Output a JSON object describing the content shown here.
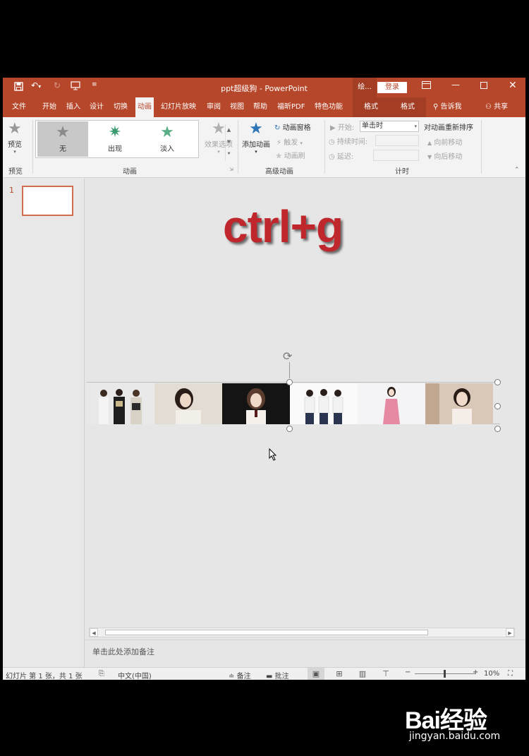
{
  "window": {
    "doc_title": "ppt超级狗 - PowerPoint",
    "tell_hint": "绘...",
    "login_label": "登录"
  },
  "tabs": [
    "文件",
    "开始",
    "插入",
    "设计",
    "切换",
    "动画",
    "幻灯片放映",
    "审阅",
    "视图",
    "帮助",
    "福昕PDF",
    "特色功能",
    "格式",
    "格式"
  ],
  "tell_me": "告诉我",
  "share": "共享",
  "ribbon": {
    "preview_label": "预览",
    "preview_group": "预览",
    "animation_gallery": [
      {
        "label": "无",
        "color": "#8a8a8a"
      },
      {
        "label": "出现",
        "color": "#3a9c6e"
      },
      {
        "label": "淡入",
        "color": "#5aae86"
      }
    ],
    "effect_options": "效果选项",
    "animation_group": "动画",
    "add_animation": "添加动画",
    "animation_pane": "动画窗格",
    "trigger": "触发",
    "animation_painter": "动画刷",
    "advanced_group": "高级动画",
    "start_label": "开始:",
    "start_value": "单击时",
    "duration_label": "持续时间:",
    "delay_label": "延迟:",
    "timing_group": "计时",
    "reorder_title": "对动画重新排序",
    "move_earlier": "向前移动",
    "move_later": "向后移动"
  },
  "thumbnails": {
    "slide_number": "1"
  },
  "slide": {
    "title": "ctrl+g"
  },
  "notes_placeholder": "单击此处添加备注",
  "status": {
    "slide_info": "幻灯片 第 1 张，共 1 张",
    "language": "中文(中国)",
    "notes_btn": "备注",
    "comments_btn": "批注",
    "zoom": "10%"
  },
  "watermark": {
    "logo": "Bai经验",
    "url": "jingyan.baidu.com"
  }
}
